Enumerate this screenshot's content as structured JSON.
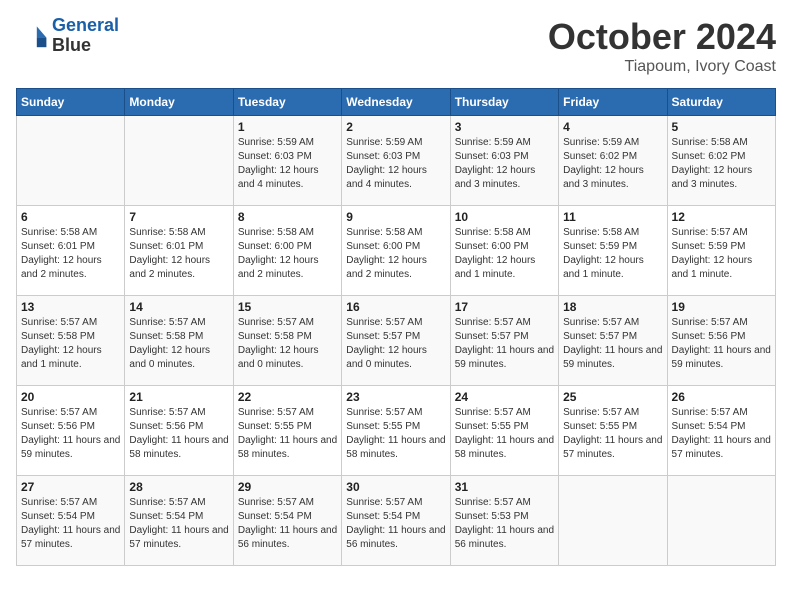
{
  "header": {
    "logo_line1": "General",
    "logo_line2": "Blue",
    "month": "October 2024",
    "location": "Tiapoum, Ivory Coast"
  },
  "days_of_week": [
    "Sunday",
    "Monday",
    "Tuesday",
    "Wednesday",
    "Thursday",
    "Friday",
    "Saturday"
  ],
  "weeks": [
    [
      {
        "day": "",
        "info": ""
      },
      {
        "day": "",
        "info": ""
      },
      {
        "day": "1",
        "info": "Sunrise: 5:59 AM\nSunset: 6:03 PM\nDaylight: 12 hours and 4 minutes."
      },
      {
        "day": "2",
        "info": "Sunrise: 5:59 AM\nSunset: 6:03 PM\nDaylight: 12 hours and 4 minutes."
      },
      {
        "day": "3",
        "info": "Sunrise: 5:59 AM\nSunset: 6:03 PM\nDaylight: 12 hours and 3 minutes."
      },
      {
        "day": "4",
        "info": "Sunrise: 5:59 AM\nSunset: 6:02 PM\nDaylight: 12 hours and 3 minutes."
      },
      {
        "day": "5",
        "info": "Sunrise: 5:58 AM\nSunset: 6:02 PM\nDaylight: 12 hours and 3 minutes."
      }
    ],
    [
      {
        "day": "6",
        "info": "Sunrise: 5:58 AM\nSunset: 6:01 PM\nDaylight: 12 hours and 2 minutes."
      },
      {
        "day": "7",
        "info": "Sunrise: 5:58 AM\nSunset: 6:01 PM\nDaylight: 12 hours and 2 minutes."
      },
      {
        "day": "8",
        "info": "Sunrise: 5:58 AM\nSunset: 6:00 PM\nDaylight: 12 hours and 2 minutes."
      },
      {
        "day": "9",
        "info": "Sunrise: 5:58 AM\nSunset: 6:00 PM\nDaylight: 12 hours and 2 minutes."
      },
      {
        "day": "10",
        "info": "Sunrise: 5:58 AM\nSunset: 6:00 PM\nDaylight: 12 hours and 1 minute."
      },
      {
        "day": "11",
        "info": "Sunrise: 5:58 AM\nSunset: 5:59 PM\nDaylight: 12 hours and 1 minute."
      },
      {
        "day": "12",
        "info": "Sunrise: 5:57 AM\nSunset: 5:59 PM\nDaylight: 12 hours and 1 minute."
      }
    ],
    [
      {
        "day": "13",
        "info": "Sunrise: 5:57 AM\nSunset: 5:58 PM\nDaylight: 12 hours and 1 minute."
      },
      {
        "day": "14",
        "info": "Sunrise: 5:57 AM\nSunset: 5:58 PM\nDaylight: 12 hours and 0 minutes."
      },
      {
        "day": "15",
        "info": "Sunrise: 5:57 AM\nSunset: 5:58 PM\nDaylight: 12 hours and 0 minutes."
      },
      {
        "day": "16",
        "info": "Sunrise: 5:57 AM\nSunset: 5:57 PM\nDaylight: 12 hours and 0 minutes."
      },
      {
        "day": "17",
        "info": "Sunrise: 5:57 AM\nSunset: 5:57 PM\nDaylight: 11 hours and 59 minutes."
      },
      {
        "day": "18",
        "info": "Sunrise: 5:57 AM\nSunset: 5:57 PM\nDaylight: 11 hours and 59 minutes."
      },
      {
        "day": "19",
        "info": "Sunrise: 5:57 AM\nSunset: 5:56 PM\nDaylight: 11 hours and 59 minutes."
      }
    ],
    [
      {
        "day": "20",
        "info": "Sunrise: 5:57 AM\nSunset: 5:56 PM\nDaylight: 11 hours and 59 minutes."
      },
      {
        "day": "21",
        "info": "Sunrise: 5:57 AM\nSunset: 5:56 PM\nDaylight: 11 hours and 58 minutes."
      },
      {
        "day": "22",
        "info": "Sunrise: 5:57 AM\nSunset: 5:55 PM\nDaylight: 11 hours and 58 minutes."
      },
      {
        "day": "23",
        "info": "Sunrise: 5:57 AM\nSunset: 5:55 PM\nDaylight: 11 hours and 58 minutes."
      },
      {
        "day": "24",
        "info": "Sunrise: 5:57 AM\nSunset: 5:55 PM\nDaylight: 11 hours and 58 minutes."
      },
      {
        "day": "25",
        "info": "Sunrise: 5:57 AM\nSunset: 5:55 PM\nDaylight: 11 hours and 57 minutes."
      },
      {
        "day": "26",
        "info": "Sunrise: 5:57 AM\nSunset: 5:54 PM\nDaylight: 11 hours and 57 minutes."
      }
    ],
    [
      {
        "day": "27",
        "info": "Sunrise: 5:57 AM\nSunset: 5:54 PM\nDaylight: 11 hours and 57 minutes."
      },
      {
        "day": "28",
        "info": "Sunrise: 5:57 AM\nSunset: 5:54 PM\nDaylight: 11 hours and 57 minutes."
      },
      {
        "day": "29",
        "info": "Sunrise: 5:57 AM\nSunset: 5:54 PM\nDaylight: 11 hours and 56 minutes."
      },
      {
        "day": "30",
        "info": "Sunrise: 5:57 AM\nSunset: 5:54 PM\nDaylight: 11 hours and 56 minutes."
      },
      {
        "day": "31",
        "info": "Sunrise: 5:57 AM\nSunset: 5:53 PM\nDaylight: 11 hours and 56 minutes."
      },
      {
        "day": "",
        "info": ""
      },
      {
        "day": "",
        "info": ""
      }
    ]
  ]
}
